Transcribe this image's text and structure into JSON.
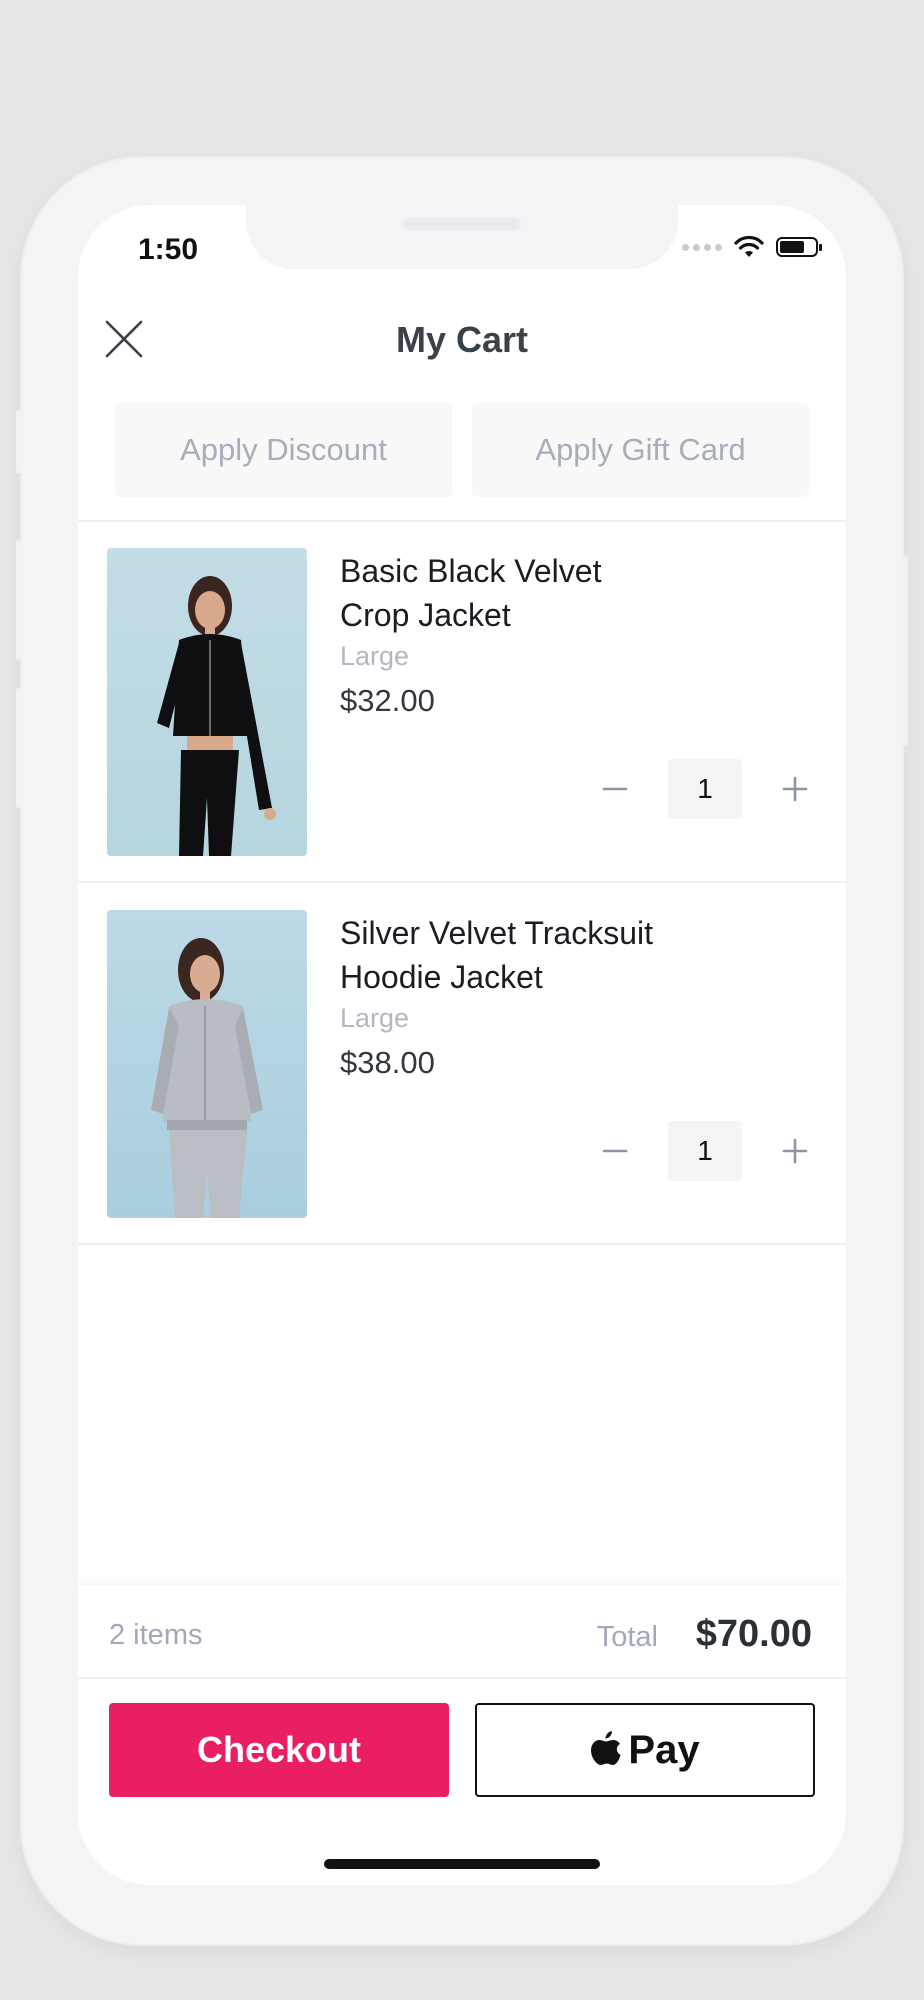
{
  "status_bar": {
    "time": "1:50"
  },
  "header": {
    "title": "My Cart"
  },
  "actions": {
    "apply_discount": "Apply Discount",
    "apply_gift_card": "Apply Gift Card"
  },
  "items": [
    {
      "name_line1": "Basic Black Velvet",
      "name_line2": "Crop Jacket",
      "size": "Large",
      "price": "$32.00",
      "quantity": "1"
    },
    {
      "name_line1": "Silver Velvet Tracksuit",
      "name_line2": "Hoodie Jacket",
      "size": "Large",
      "price": "$38.00",
      "quantity": "1"
    }
  ],
  "summary": {
    "count": "2 items",
    "total_label": "Total",
    "total_value": "$70.00"
  },
  "buttons": {
    "checkout": "Checkout",
    "apple_pay": "Pay"
  },
  "colors": {
    "accent": "#e91e63",
    "muted_text": "#a8adbc",
    "title_text": "#3a4148"
  }
}
